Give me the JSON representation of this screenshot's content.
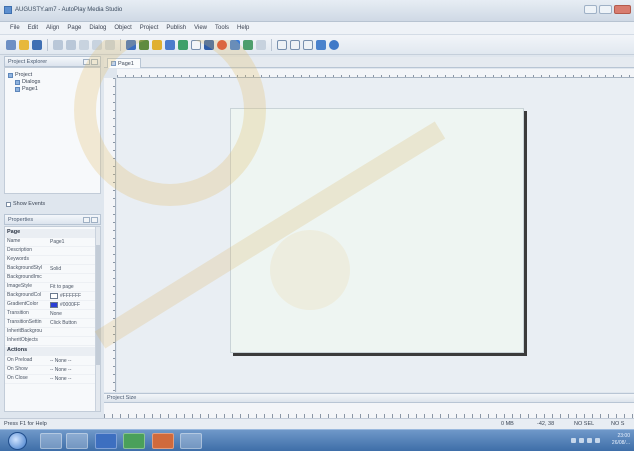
{
  "window": {
    "title": "AUGUSTY.am7 - AutoPlay Media Studio"
  },
  "menu": [
    "File",
    "Edit",
    "Align",
    "Page",
    "Dialog",
    "Object",
    "Project",
    "Publish",
    "View",
    "Tools",
    "Help"
  ],
  "toolbar_icons": [
    "new-icon",
    "open-icon",
    "save-icon",
    "undo-icon",
    "redo-icon",
    "cut-icon",
    "copy-icon",
    "paste-icon",
    "button-object-icon",
    "image-object-icon",
    "paragraph-object-icon",
    "label-object-icon",
    "input-object-icon",
    "checkbox-object-icon",
    "combobox-object-icon",
    "flash-object-icon",
    "video-object-icon",
    "web-object-icon",
    "zoom-icon",
    "page-icon",
    "dialog-icon",
    "preview-icon",
    "publish-icon",
    "help-icon"
  ],
  "explorer": {
    "header": "Project Explorer",
    "tree": [
      "Project",
      "Dialogs",
      "Page1"
    ],
    "show_events": "Show Events"
  },
  "properties": {
    "header": "Properties",
    "groups": [
      {
        "label": "Page",
        "rows": [
          {
            "key": "Name",
            "value": "Page1"
          },
          {
            "key": "Description",
            "value": ""
          },
          {
            "key": "Keywords",
            "value": ""
          },
          {
            "key": "BackgroundStyl",
            "value": "Solid"
          },
          {
            "key": "BackgroundImc",
            "value": ""
          },
          {
            "key": "ImageStyle",
            "value": "Fit to page"
          },
          {
            "key": "BackgroundCol",
            "value": "#FFFFFF"
          },
          {
            "key": "GradientColor",
            "value": "#0000FF"
          },
          {
            "key": "Transition",
            "value": "None"
          },
          {
            "key": "TransitionSettin",
            "value": "Click Button"
          },
          {
            "key": "InheritBackgrou",
            "value": ""
          },
          {
            "key": "InheritObjects",
            "value": ""
          }
        ]
      },
      {
        "label": "Actions",
        "rows": [
          {
            "key": "On Preload",
            "value": "-- None --"
          },
          {
            "key": "On Show",
            "value": "-- None --"
          },
          {
            "key": "On Close",
            "value": "-- None --"
          }
        ]
      }
    ]
  },
  "tab": {
    "label": "Page1"
  },
  "tray_label": "Project Size",
  "status": {
    "help": "Press F1 for Help",
    "memory": "0 MB",
    "coords": "-42, 38",
    "sel1": "NO SEL",
    "sel2": "NO S"
  },
  "colors": {
    "background_col": "#FFFFFF",
    "gradient_col": "#0000FF"
  },
  "clock": {
    "time": "23:00",
    "date": "26/08/..."
  }
}
